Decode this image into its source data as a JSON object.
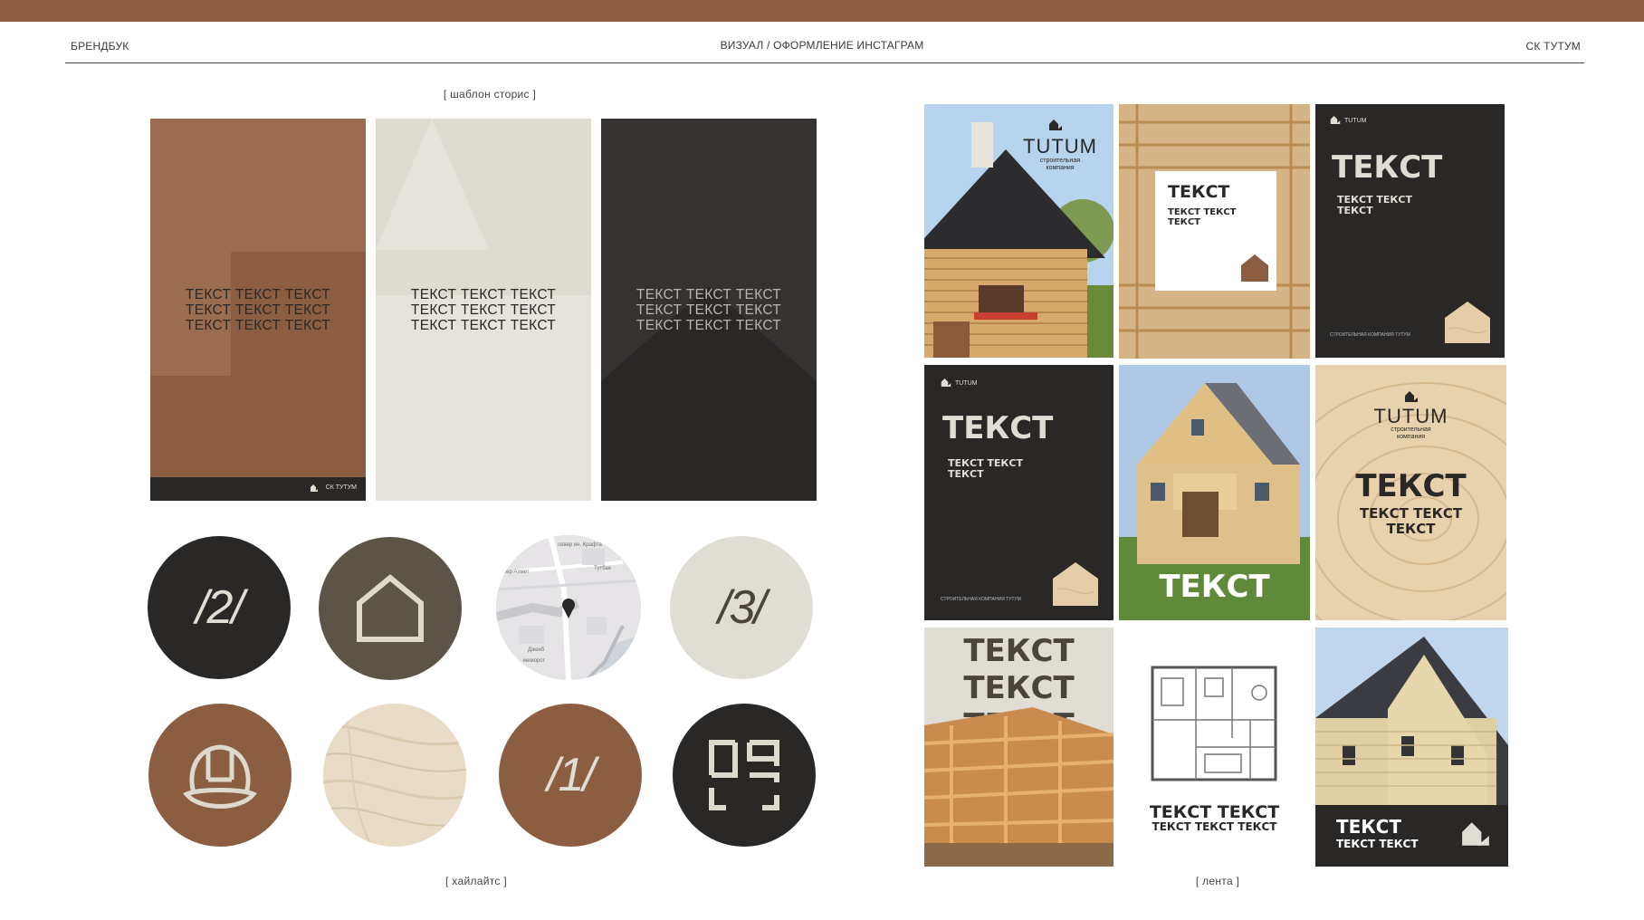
{
  "header": {
    "left": "БРЕНДБУК",
    "center": "ВИЗУАЛ / ОФОРМЛЕНИЕ ИНСТАГРАМ",
    "right": "СК ТУТУМ"
  },
  "captions": {
    "stories": "[ шаблон сторис ]",
    "highlights": "[ хайлайтс ]",
    "feed": "[ лента ]"
  },
  "stories": [
    {
      "lines": [
        "ТЕКСТ ТЕКСТ ТЕКСТ",
        "ТЕКСТ ТЕКСТ ТЕКСТ",
        "ТЕКСТ ТЕКСТ ТЕКСТ"
      ],
      "footer": "СК ТУТУМ"
    },
    {
      "lines": [
        "ТЕКСТ ТЕКСТ ТЕКСТ",
        "ТЕКСТ ТЕКСТ ТЕКСТ",
        "ТЕКСТ ТЕКСТ ТЕКСТ"
      ]
    },
    {
      "lines": [
        "ТЕКСТ ТЕКСТ ТЕКСТ",
        "ТЕКСТ ТЕКСТ ТЕКСТ",
        "ТЕКСТ ТЕКСТ ТЕКСТ"
      ]
    }
  ],
  "highlights": {
    "row1": [
      {
        "label": "/2/",
        "bg": "#2a2827"
      },
      {
        "icon": "house-outline-icon",
        "bg": "#5c5446"
      },
      {
        "icon": "map-pin-icon",
        "bg": "#e6e4e6",
        "map_labels": [
          "север ин. Крафта",
          "свер Ахмет",
          "Тутбае",
          "Джеиб",
          "меморог"
        ]
      },
      {
        "label": "/3/",
        "bg": "#e0ddd4"
      }
    ],
    "row2": [
      {
        "icon": "hard-hat-icon",
        "bg": "#8b5e42"
      },
      {
        "icon": "wood-texture-icon",
        "bg": "#e6dac5"
      },
      {
        "label": "/1/",
        "bg": "#8b5e42"
      },
      {
        "icon": "floor-plan-icon",
        "bg": "#2a2827"
      }
    ]
  },
  "feed": {
    "brand": "TUTUM",
    "brand_sub": "строительная компания",
    "small_brand": "TUTUM",
    "tiles": {
      "t1": {
        "brand": "TUTUM",
        "sub": [
          "строительная",
          "компания"
        ]
      },
      "t2": {
        "title": "ТЕКСТ",
        "sub": [
          "ТЕКСТ ТЕКСТ",
          "ТЕКСТ"
        ]
      },
      "t3": {
        "title": "ТЕКСТ",
        "sub": [
          "ТЕКСТ ТЕКСТ",
          "ТЕКСТ"
        ],
        "footer": "СТРОИТЕЛЬНАЯ КОМПАНИЯ ТУТУМ"
      },
      "t4": {
        "title": "ТЕКСТ",
        "sub": [
          "ТЕКСТ ТЕКСТ",
          "ТЕКСТ"
        ],
        "footer": "СТРОИТЕЛЬНАЯ КОМПАНИЯ ТУТУМ"
      },
      "t5": {
        "title": "ТЕКСТ"
      },
      "t6": {
        "brand": "TUTUM",
        "sub": [
          "строительная",
          "компания"
        ],
        "title": "ТЕКСТ",
        "lines": [
          "ТЕКСТ ТЕКСТ",
          "ТЕКСТ"
        ]
      },
      "t7": {
        "lines": [
          "ТЕКСТ",
          "ТЕКСТ",
          "ТЕКСТ"
        ]
      },
      "t8": {
        "lines": [
          "ТЕКСТ ТЕКСТ",
          "ТЕКСТ ТЕКСТ ТЕКСТ"
        ]
      },
      "t9": {
        "lines": [
          "ТЕКСТ",
          "ТЕКСТ ТЕКСТ"
        ]
      }
    }
  },
  "colors": {
    "brown": "#8b5e42",
    "dark": "#2a2827",
    "olive": "#5c5446",
    "beige": "#e0ddd4",
    "light": "#e6e4e0"
  }
}
